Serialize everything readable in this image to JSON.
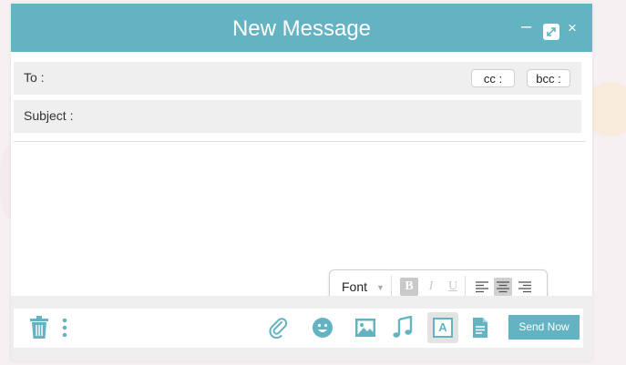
{
  "colors": {
    "accent": "#64b3c2",
    "field_bg": "#efefef"
  },
  "window": {
    "title": "New Message",
    "controls": [
      "minimize-icon",
      "expand-icon",
      "close-icon"
    ],
    "minimize_glyph": "–",
    "close_glyph": "×"
  },
  "to": {
    "label": "To :",
    "value": "",
    "cc_label": "cc :",
    "bcc_label": "bcc :"
  },
  "subject": {
    "label": "Subject :",
    "value": ""
  },
  "message_body": {
    "value": ""
  },
  "format_toolbar": {
    "font_label": "Font",
    "bold_label": "B",
    "italic_label": "I",
    "underline_label": "U",
    "alignment_options": [
      "align-left-icon",
      "align-center-icon",
      "align-right-icon"
    ],
    "selected_alignment": "center",
    "bold_active": true
  },
  "footer": {
    "icons": [
      "trash-icon",
      "more-vertical-icon",
      "attachment-icon",
      "emoji-icon",
      "image-icon",
      "music-icon",
      "text-format-icon",
      "document-icon"
    ],
    "text_format_glyph": "A",
    "send_label": "Send Now"
  }
}
